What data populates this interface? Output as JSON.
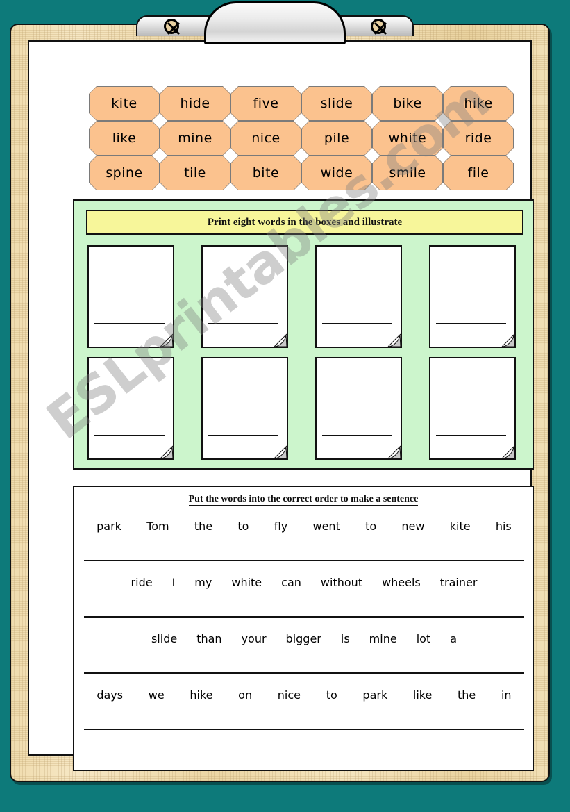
{
  "colors": {
    "background_teal": "#0d7a7a",
    "clipboard_wood": "#f0dcae",
    "tile_orange": "#fbc28e",
    "panel_green": "#ccf5cc",
    "banner_yellow": "#f7f69a",
    "paper_white": "#ffffff",
    "ink_black": "#111111"
  },
  "clipboard": {
    "clip_head_name": "clipboard-clip",
    "rivet_icon": "screw-cross-icon"
  },
  "word_tiles": {
    "rows": [
      [
        "kite",
        "hide",
        "five",
        "slide",
        "bike",
        "hike"
      ],
      [
        "like",
        "mine",
        "nice",
        "pile",
        "white",
        "ride"
      ],
      [
        "spine",
        "tile",
        "bite",
        "wide",
        "smile",
        "file"
      ]
    ]
  },
  "illustrate_section": {
    "banner_text": "Print eight words in the boxes and illustrate",
    "box_count": 8,
    "boxes": [
      {
        "value": ""
      },
      {
        "value": ""
      },
      {
        "value": ""
      },
      {
        "value": ""
      },
      {
        "value": ""
      },
      {
        "value": ""
      },
      {
        "value": ""
      },
      {
        "value": ""
      }
    ],
    "curl_icon": "page-curl-icon"
  },
  "sentence_section": {
    "heading": "Put the words into the correct order to make a sentence",
    "rows": [
      {
        "words": [
          "park",
          "Tom",
          "the",
          "to",
          "fly",
          "went",
          "to",
          "new",
          "kite",
          "his"
        ],
        "answer_value": ""
      },
      {
        "words": [
          "ride",
          "I",
          "my",
          "white",
          "can",
          "without",
          "wheels",
          "trainer"
        ],
        "answer_value": ""
      },
      {
        "words": [
          "slide",
          "than",
          "your",
          "bigger",
          "is",
          "mine",
          "lot",
          "a"
        ],
        "answer_value": ""
      },
      {
        "words": [
          "days",
          "we",
          "hike",
          "on",
          "nice",
          "to",
          "park",
          "like",
          "the",
          "in"
        ],
        "answer_value": ""
      }
    ]
  },
  "watermark": {
    "text": "ESLprintables.com"
  }
}
